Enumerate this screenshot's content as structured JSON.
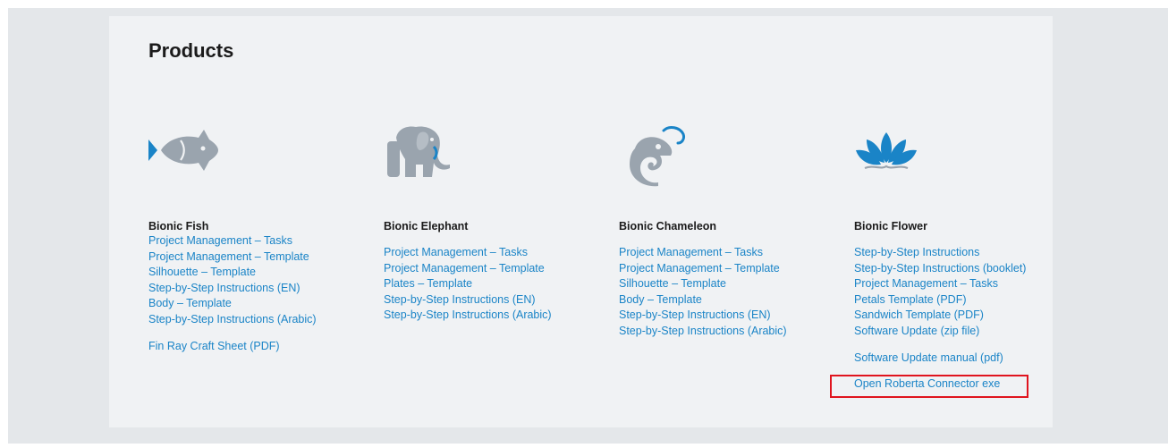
{
  "page": {
    "title": "Products"
  },
  "accent_color": "#1a84c7",
  "highlight_color": "#e0141e",
  "products": [
    {
      "icon": "fish-icon",
      "name": "Bionic Fish",
      "links": [
        "Project Management – Tasks",
        "Project Management – Template",
        "Silhouette – Template",
        "Step-by-Step Instructions (EN)",
        "Body – Template",
        "Step-by-Step Instructions (Arabic)"
      ],
      "extra_links": [
        "Fin Ray Craft Sheet (PDF)"
      ]
    },
    {
      "icon": "elephant-icon",
      "name": "Bionic Elephant",
      "links": [
        "Project Management – Tasks",
        "Project Management – Template",
        "Plates – Template",
        "Step-by-Step Instructions (EN)",
        "Step-by-Step Instructions (Arabic)"
      ],
      "extra_links": []
    },
    {
      "icon": "chameleon-icon",
      "name": "Bionic Chameleon",
      "links": [
        "Project Management – Tasks",
        "Project Management – Template",
        "Silhouette – Template",
        "Body – Template",
        "Step-by-Step Instructions (EN)",
        "Step-by-Step Instructions (Arabic)"
      ],
      "extra_links": []
    },
    {
      "icon": "lotus-flower-icon",
      "name": "Bionic Flower",
      "links": [
        "Step-by-Step Instructions",
        "Step-by-Step Instructions (booklet)",
        "Project Management – Tasks",
        "Petals Template (PDF)",
        "Sandwich Template (PDF)",
        "Software Update (zip file)"
      ],
      "extra_links": [
        "Software Update manual (pdf)",
        "Open Roberta Connector exe"
      ]
    }
  ]
}
